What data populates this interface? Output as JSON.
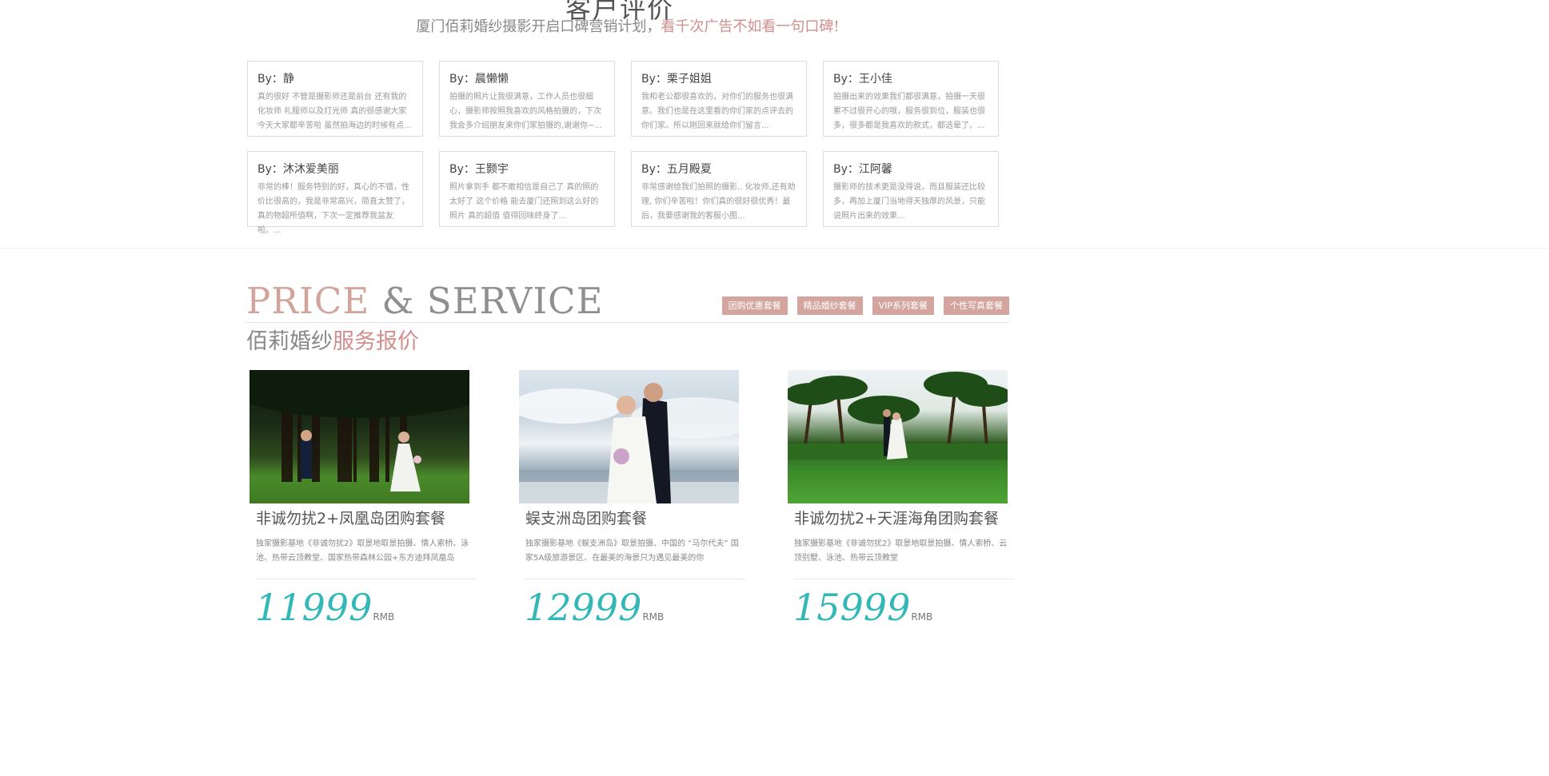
{
  "reviews": {
    "title": "客户评价",
    "subtitle_main": "厦门佰莉婚纱摄影开启口碑营销计划，",
    "subtitle_highlight": "看千次广告不如看一句口碑!",
    "items": [
      {
        "author": "By：静",
        "text": "真的很好 不管是摄影师还是前台 还有我的化妆师 礼服师以及灯光师 真的很感谢大家 今天大家都辛苦啦 虽然拍海边的时候有点..."
      },
      {
        "author": "By：晨懒懒",
        "text": "拍摄的照片让我很满意，工作人员也很细心，摄影师按照我喜欢的风格拍摄的，下次我会多介绍朋友来你们家拍摄的,谢谢你~..."
      },
      {
        "author": "By：栗子姐姐",
        "text": "我和老公都很喜欢的，对你们的服务也很满意。我们也是在这里看的你们家的点评去的你们家。所以刚回来就给你们留言..."
      },
      {
        "author": "By：王小佳",
        "text": "拍摄出来的效果我们都很满意，拍摄一天很累不过很开心的哦，服务很到位，服装也很多，很多都是我喜欢的款式，都选晕了。..."
      },
      {
        "author": "By：沐沐爱美丽",
        "text": "非常的棒！服务特别的好，真心的不错，性价比很高的，我是非常高兴，简直太赞了，真的物超所值啊，下次一定推荐我盆友啦。..."
      },
      {
        "author": "By：王颢宇",
        "text": "照片拿到手 都不敢相信是自己了 真的照的太好了 这个价格 能去厦门还照到这么好的照片 真的超值 值得回味终身了..."
      },
      {
        "author": "By：五月殿夏",
        "text": "非常感谢给我们拍照的摄影.. 化妆师,还有助理, 你们辛苦啦！你们真的很好很优秀！最后，我要感谢我的客服小图..."
      },
      {
        "author": "By：江阿馨",
        "text": "摄影师的技术更是没得说，而且服装还比较多，再加上厦门当地得天独厚的风景，只能说照片出来的效果..."
      }
    ]
  },
  "price_section": {
    "heading_word1": "PRICE",
    "heading_amp": "&",
    "heading_word2": "SERVICE",
    "subtitle_main": "佰莉婚纱",
    "subtitle_highlight": "服务报价",
    "tabs": [
      "团购优惠套餐",
      "精品婚纱套餐",
      "VIP系列套餐",
      "个性写真套餐"
    ],
    "accent_color": "#d4a59e",
    "price_color": "#33b7b7"
  },
  "packages": [
    {
      "name": "非诚勿扰2+凤凰岛团购套餐",
      "desc": "独家摄影基地《非诚勿扰2》取景地取景拍摄、情人索桥、泳池、热带云顶教堂、国家热带森林公园+东方迪拜凤凰岛",
      "price": "11999",
      "unit": "RMB",
      "photo": "forest-wedding-photo"
    },
    {
      "name": "蜈支洲岛团购套餐",
      "desc": "独家摄影基地《蜈支洲岛》取景拍摄、中国的 “马尔代夫” 国家5A级旅游景区、在最美的海景只为遇见最美的你",
      "price": "12999",
      "unit": "RMB",
      "photo": "beach-wedding-photo"
    },
    {
      "name": "非诚勿扰2+天涯海角团购套餐",
      "desc": "独家摄影基地《非诚勿扰2》取景地取景拍摄、情人索桥、云顶别墅、泳池、热带云顶教堂",
      "price": "15999",
      "unit": "RMB",
      "photo": "palm-lawn-wedding-photo"
    }
  ]
}
